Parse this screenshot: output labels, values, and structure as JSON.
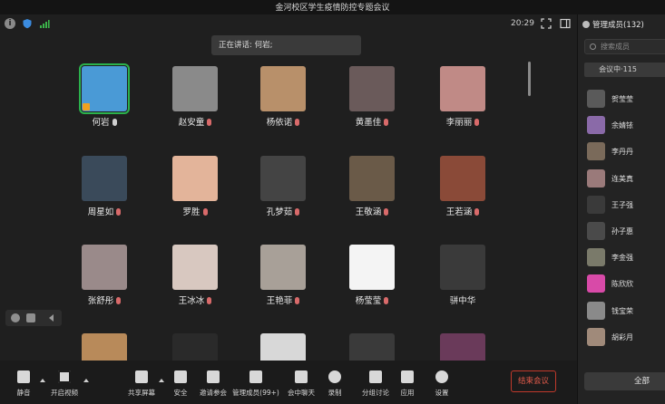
{
  "window": {
    "title": "金河校区学生疫情防控专题会议"
  },
  "topbar": {
    "icons": [
      "info-icon",
      "shield-icon",
      "signal-icon",
      "fullscreen-icon",
      "layout-icon"
    ],
    "time": "20:29"
  },
  "speaking": {
    "text": "正在讲话: 何岩;"
  },
  "grid": {
    "participants": [
      {
        "name": "何岩",
        "muted": false,
        "active": true,
        "host": true,
        "color": "#4a9ad6"
      },
      {
        "name": "赵安童",
        "muted": true,
        "color": "#8a8a8a"
      },
      {
        "name": "杨依诺",
        "muted": true,
        "color": "#b8906a"
      },
      {
        "name": "黄墨佳",
        "muted": true,
        "color": "#6a5a5a"
      },
      {
        "name": "李丽丽",
        "muted": true,
        "color": "#c08a86"
      },
      {
        "name": "周星如",
        "muted": true,
        "color": "#3a4a5a"
      },
      {
        "name": "罗胜",
        "muted": true,
        "color": "#e3b49a"
      },
      {
        "name": "孔梦茹",
        "muted": true,
        "color": "#444"
      },
      {
        "name": "王敬涵",
        "muted": true,
        "color": "#6a5a48"
      },
      {
        "name": "王若涵",
        "muted": true,
        "color": "#8a4a38"
      },
      {
        "name": "张舒彤",
        "muted": true,
        "color": "#9a8a8a"
      },
      {
        "name": "王冰冰",
        "muted": true,
        "color": "#d8c8c0"
      },
      {
        "name": "王艳菲",
        "muted": true,
        "color": "#a8a098"
      },
      {
        "name": "杨莹莹",
        "muted": true,
        "color": "#f4f4f4"
      },
      {
        "name": "骈中华",
        "muted": null,
        "color": "#3a3a3a"
      },
      {
        "name": "",
        "muted": null,
        "color": "#b88a5a"
      },
      {
        "name": "",
        "muted": null,
        "color": "#2a2a2a"
      },
      {
        "name": "",
        "muted": null,
        "color": "#d8d8d8"
      },
      {
        "name": "",
        "muted": null,
        "color": "#3a3a3a"
      },
      {
        "name": "",
        "muted": null,
        "color": "#6a3a5a"
      }
    ]
  },
  "panel": {
    "header": "管理成员(132)",
    "search_placeholder": "搜索成员",
    "tab": "会议中·115",
    "members": [
      {
        "name": "贺莹莹",
        "color": "#5a5a5a"
      },
      {
        "name": "余婧铱",
        "color": "#8a6aa8"
      },
      {
        "name": "李丹丹",
        "color": "#7a6a5a"
      },
      {
        "name": "连美真",
        "color": "#9a7a7a"
      },
      {
        "name": "王子强",
        "color": "#3a3a3a"
      },
      {
        "name": "孙子惠",
        "color": "#4a4a4a"
      },
      {
        "name": "李金强",
        "color": "#7a7a6a"
      },
      {
        "name": "陈欣欣",
        "color": "#d84aa8"
      },
      {
        "name": "钱宝荣",
        "color": "#8a8a8a"
      },
      {
        "name": "胡彩月",
        "color": "#a08a7a"
      }
    ],
    "all_button": "全部"
  },
  "toolbar": {
    "buttons": [
      {
        "label": "静音",
        "icon": "microphone-icon"
      },
      {
        "label": "开启视频",
        "icon": "video-off-icon"
      },
      {
        "label": "共享屏幕",
        "icon": "share-screen-icon"
      },
      {
        "label": "安全",
        "icon": "shield-check-icon"
      },
      {
        "label": "邀请参会",
        "icon": "add-user-icon"
      },
      {
        "label": "管理成员(99+)",
        "icon": "members-icon"
      },
      {
        "label": "会中聊天",
        "icon": "chat-icon"
      },
      {
        "label": "录制",
        "icon": "record-icon"
      },
      {
        "label": "分组讨论",
        "icon": "breakout-icon"
      },
      {
        "label": "应用",
        "icon": "apps-icon"
      },
      {
        "label": "设置",
        "icon": "settings-icon"
      }
    ],
    "end_label": "结束会议"
  }
}
